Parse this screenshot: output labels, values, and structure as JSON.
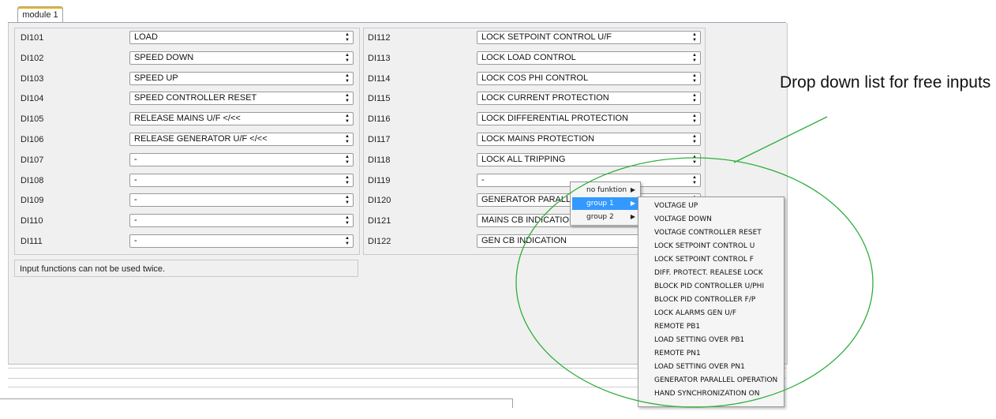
{
  "tab": {
    "label": "module 1"
  },
  "left_column": [
    {
      "id": "DI101",
      "value": "LOAD"
    },
    {
      "id": "DI102",
      "value": "SPEED DOWN"
    },
    {
      "id": "DI103",
      "value": "SPEED UP"
    },
    {
      "id": "DI104",
      "value": "SPEED CONTROLLER RESET"
    },
    {
      "id": "DI105",
      "value": "RELEASE MAINS U/F </<<"
    },
    {
      "id": "DI106",
      "value": "RELEASE GENERATOR U/F </<<"
    },
    {
      "id": "DI107",
      "value": "-"
    },
    {
      "id": "DI108",
      "value": "-"
    },
    {
      "id": "DI109",
      "value": "-"
    },
    {
      "id": "DI110",
      "value": "-"
    },
    {
      "id": "DI111",
      "value": "-"
    }
  ],
  "right_column": [
    {
      "id": "DI112",
      "value": "LOCK SETPOINT CONTROL U/F"
    },
    {
      "id": "DI113",
      "value": "LOCK LOAD CONTROL"
    },
    {
      "id": "DI114",
      "value": "LOCK COS PHI CONTROL"
    },
    {
      "id": "DI115",
      "value": "LOCK CURRENT PROTECTION"
    },
    {
      "id": "DI116",
      "value": "LOCK DIFFERENTIAL PROTECTION"
    },
    {
      "id": "DI117",
      "value": "LOCK MAINS PROTECTION"
    },
    {
      "id": "DI118",
      "value": "LOCK ALL TRIPPING"
    },
    {
      "id": "DI119",
      "value": "-"
    },
    {
      "id": "DI120",
      "value": "GENERATOR PARALL"
    },
    {
      "id": "DI121",
      "value": "MAINS CB INDICATION"
    },
    {
      "id": "DI122",
      "value": "GEN CB INDICATION"
    }
  ],
  "note": "Input functions can not be used twice.",
  "context_menu": {
    "items": [
      {
        "label": "no funktion"
      },
      {
        "label": "group 1"
      },
      {
        "label": "group 2"
      }
    ],
    "selected_index": 1
  },
  "submenu": [
    "VOLTAGE UP",
    "VOLTAGE DOWN",
    "VOLTAGE CONTROLLER RESET",
    "LOCK SETPOINT CONTROL U",
    "LOCK SETPOINT CONTROL F",
    "DIFF. PROTECT. REALESE LOCK",
    "BLOCK PID CONTROLLER U/PHI",
    "BLOCK PID CONTROLLER F/P",
    "LOCK ALARMS GEN U/F",
    "REMOTE PB1",
    "LOAD SETTING OVER PB1",
    "REMOTE PN1",
    "LOAD SETTING OVER PN1",
    "GENERATOR PARALLEL OPERATION",
    "HAND SYNCHRONIZATION ON"
  ],
  "callout": "Drop down list for free inputs",
  "colors": {
    "highlight": "#3399ff",
    "annotation": "#2eae3a",
    "background": "#f0f0f0"
  }
}
